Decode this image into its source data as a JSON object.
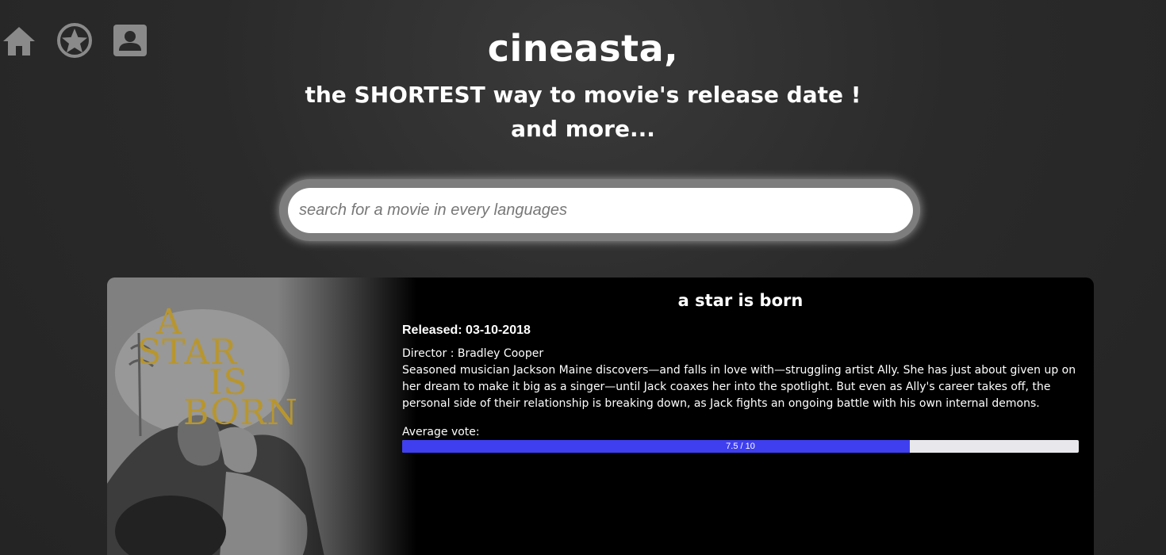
{
  "nav": {
    "icons": [
      "home-icon",
      "star-icon",
      "account-icon"
    ]
  },
  "header": {
    "title": "cineasta,",
    "tagline": "the SHORTEST way to movie's release date ! and more..."
  },
  "search": {
    "placeholder": "search for a movie in every languages",
    "value": ""
  },
  "movie": {
    "poster_text": [
      "A",
      "STAR",
      "IS",
      "BORN"
    ],
    "title": "a star is born",
    "released": "Released: 03-10-2018",
    "director": "Director : Bradley Cooper",
    "overview": "Seasoned musician Jackson Maine discovers—and falls in love with—struggling artist Ally. She has just about given up on her dream to make it big as a singer—until Jack coaxes her into the spotlight. But even as Ally's career takes off, the personal side of their relationship is breaking down, as Jack fights an ongoing battle with his own internal demons.",
    "vote_label": "Average vote:",
    "vote_value": 7.5,
    "vote_max": 10,
    "vote_text": "7.5 / 10"
  },
  "colors": {
    "vote_fill": "#3f3ff0",
    "vote_track": "#e8e8ec",
    "poster_title": "#b8962f",
    "icon": "#8a8a8a"
  }
}
